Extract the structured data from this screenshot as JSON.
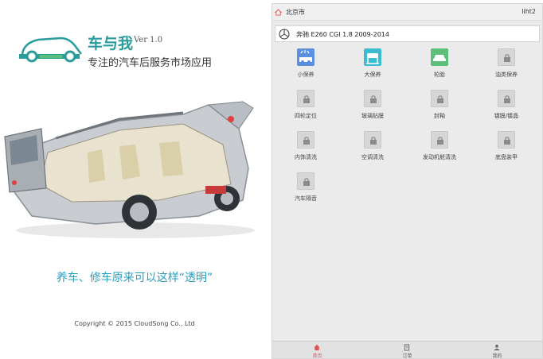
{
  "splash": {
    "brand_name": "车与我",
    "version": "Ver 1.0",
    "tagline": "专注的汽车后服务市场应用",
    "slogan": "养车、修车原来可以这样“透明”",
    "copyright": "Copyright © 2015 CloudSong Co., Ltd"
  },
  "app": {
    "city": "北京市",
    "user": "liht2",
    "car_model": "奔驰  E260 CGI  1.8 2009-2014",
    "services": [
      {
        "label": "小保养",
        "icon": "car-wash-icon",
        "color": "#5b8fe0",
        "locked": false
      },
      {
        "label": "大保养",
        "icon": "car-lift-icon",
        "color": "#3cbcd0",
        "locked": false
      },
      {
        "label": "轮胎",
        "icon": "tire-car-icon",
        "color": "#5cc07a",
        "locked": false
      },
      {
        "label": "油类保养",
        "icon": "lock-icon",
        "locked": true
      },
      {
        "label": "四轮定位",
        "icon": "lock-icon",
        "locked": true
      },
      {
        "label": "玻璃贴膜",
        "icon": "lock-icon",
        "locked": true
      },
      {
        "label": "封釉",
        "icon": "lock-icon",
        "locked": true
      },
      {
        "label": "镀膜/镀晶",
        "icon": "lock-icon",
        "locked": true
      },
      {
        "label": "内饰清洗",
        "icon": "lock-icon",
        "locked": true
      },
      {
        "label": "空调清洗",
        "icon": "lock-icon",
        "locked": true
      },
      {
        "label": "发动机舱清洗",
        "icon": "lock-icon",
        "locked": true
      },
      {
        "label": "底盘装甲",
        "icon": "lock-icon",
        "locked": true
      },
      {
        "label": "汽车隔音",
        "icon": "lock-icon",
        "locked": true
      }
    ],
    "tabs": [
      {
        "label": "首页",
        "icon": "home-icon",
        "active": true
      },
      {
        "label": "订单",
        "icon": "order-icon",
        "active": false
      },
      {
        "label": "我的",
        "icon": "profile-icon",
        "active": false
      }
    ],
    "colors": {
      "accent": "#e05454",
      "brand": "#2a9c9c",
      "slogan": "#2a9fc0"
    }
  }
}
